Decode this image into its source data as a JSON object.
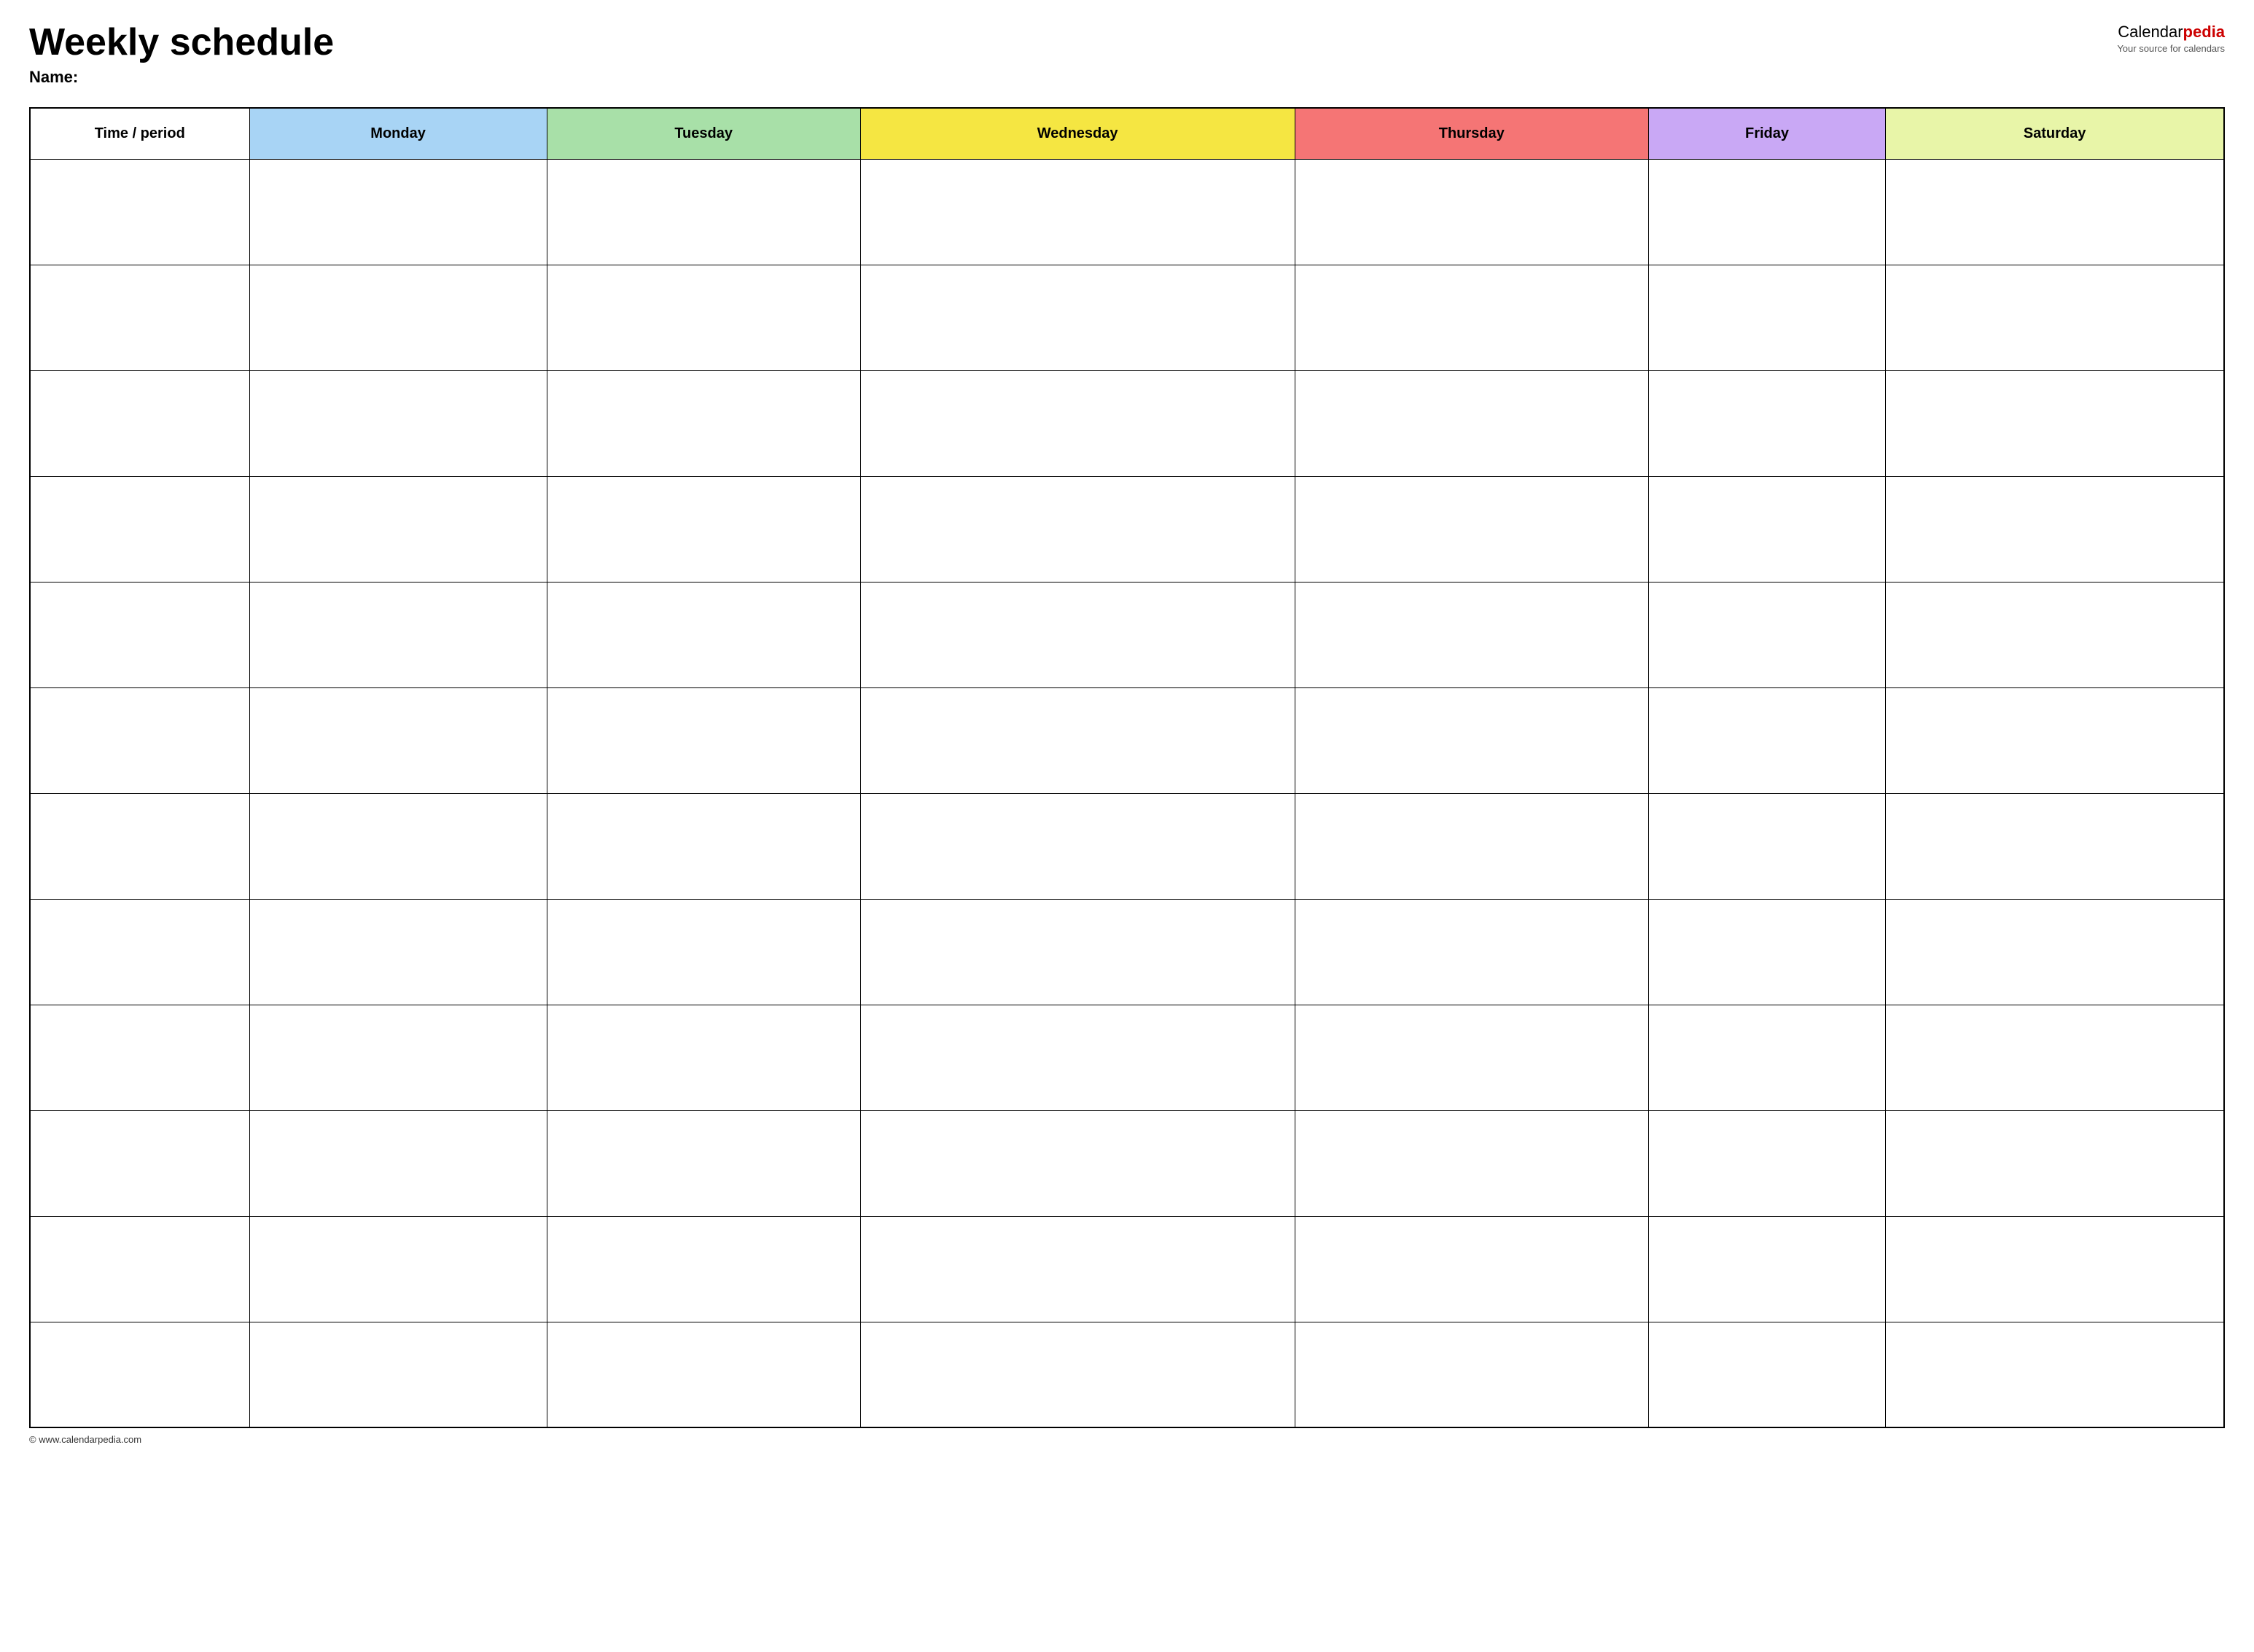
{
  "header": {
    "title": "Weekly schedule",
    "name_label": "Name:",
    "logo_text_calendar": "Calendar",
    "logo_text_pedia": "pedia",
    "logo_tagline": "Your source for calendars"
  },
  "table": {
    "columns": [
      {
        "key": "time",
        "label": "Time / period",
        "color": "#ffffff",
        "class": "col-time"
      },
      {
        "key": "monday",
        "label": "Monday",
        "color": "#a8d4f5",
        "class": "col-monday"
      },
      {
        "key": "tuesday",
        "label": "Tuesday",
        "color": "#a8e0a8",
        "class": "col-tuesday"
      },
      {
        "key": "wednesday",
        "label": "Wednesday",
        "color": "#f5e642",
        "class": "col-wednesday"
      },
      {
        "key": "thursday",
        "label": "Thursday",
        "color": "#f57575",
        "class": "col-thursday"
      },
      {
        "key": "friday",
        "label": "Friday",
        "color": "#c9a8f5",
        "class": "col-friday"
      },
      {
        "key": "saturday",
        "label": "Saturday",
        "color": "#e8f5a8",
        "class": "col-saturday"
      }
    ],
    "rows": 12
  },
  "footer": {
    "url": "© www.calendarpedia.com"
  }
}
